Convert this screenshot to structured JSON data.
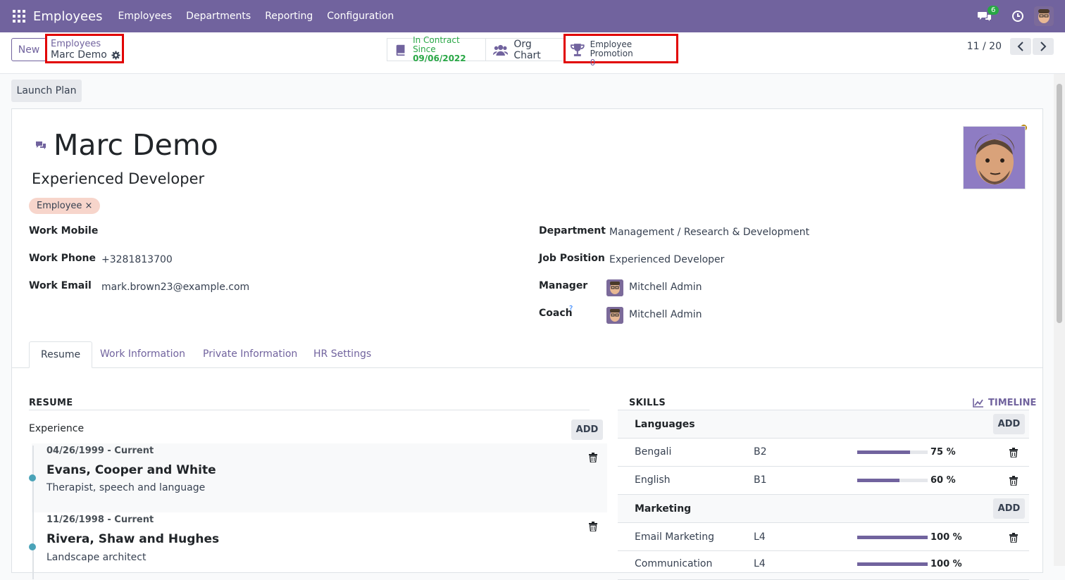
{
  "navbar": {
    "app_title": "Employees",
    "menus": [
      "Employees",
      "Departments",
      "Reporting",
      "Configuration"
    ],
    "chat_count": "6"
  },
  "control": {
    "new_label": "New",
    "breadcrumb_parent": "Employees",
    "breadcrumb_current": "Marc Demo",
    "contract_label": "In Contract Since",
    "contract_date": "09/06/2022",
    "org_chart_label": "Org Chart",
    "promotion_label": "Employee Promotion",
    "promotion_value": "0",
    "pager": "11 / 20"
  },
  "status": {
    "launch_plan": "Launch Plan"
  },
  "employee": {
    "name": "Marc Demo",
    "job_title": "Experienced Developer",
    "tag": "Employee"
  },
  "fields": {
    "work_mobile_label": "Work Mobile",
    "work_mobile": "",
    "work_phone_label": "Work Phone",
    "work_phone": "+3281813700",
    "work_email_label": "Work Email",
    "work_email": "mark.brown23@example.com",
    "department_label": "Department",
    "department": "Management / Research & Development",
    "job_position_label": "Job Position",
    "job_position": "Experienced Developer",
    "manager_label": "Manager",
    "manager": "Mitchell Admin",
    "coach_label": "Coach",
    "coach_help": "?",
    "coach": "Mitchell Admin"
  },
  "tabs": [
    "Resume",
    "Work Information",
    "Private Information",
    "HR Settings"
  ],
  "resume": {
    "header": "RESUME",
    "group": "Experience",
    "add": "ADD",
    "items": [
      {
        "date": "04/26/1999 - Current",
        "name": "Evans, Cooper and White",
        "desc": "Therapist, speech and language"
      },
      {
        "date": "11/26/1998 - Current",
        "name": "Rivera, Shaw and Hughes",
        "desc": "Landscape architect"
      }
    ]
  },
  "skills": {
    "header": "SKILLS",
    "timeline": "TIMELINE",
    "add": "ADD",
    "groups": [
      {
        "name": "Languages",
        "rows": [
          {
            "name": "Bengali",
            "level": "B2",
            "progress": 75,
            "pct": "75 %"
          },
          {
            "name": "English",
            "level": "B1",
            "progress": 60,
            "pct": "60 %"
          }
        ]
      },
      {
        "name": "Marketing",
        "rows": [
          {
            "name": "Email Marketing",
            "level": "L4",
            "progress": 100,
            "pct": "100 %"
          },
          {
            "name": "Communication",
            "level": "L4",
            "progress": 100,
            "pct": "100 %"
          }
        ]
      }
    ]
  },
  "colors": {
    "brand": "#71639e",
    "highlight": "#e10000",
    "tag_bg": "#f7d5cb",
    "timeline_dot": "#4aa3b8",
    "status_dot": "#b8860b"
  }
}
